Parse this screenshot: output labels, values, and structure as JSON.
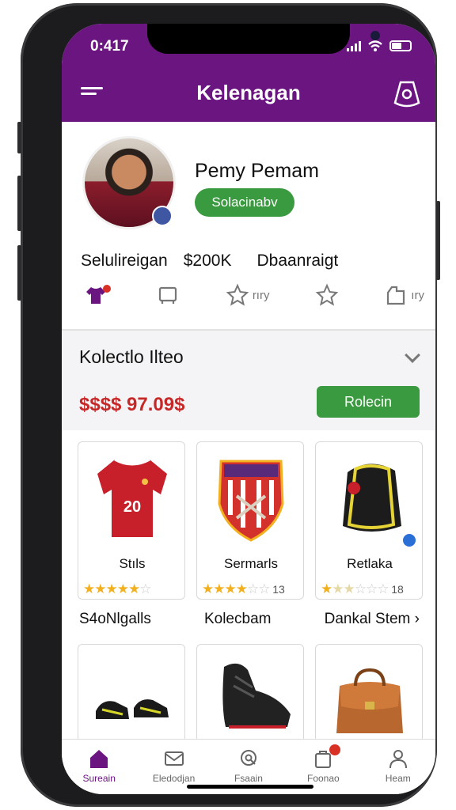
{
  "status_bar": {
    "time": "0:417"
  },
  "header": {
    "title": "Kelenagan"
  },
  "profile": {
    "name": "Pemy Pemam",
    "status": "Solacinabv",
    "stats": [
      "Selulireigan",
      "$200K",
      "Dbaanraigt"
    ]
  },
  "quick_actions": [
    {
      "icon": "jersey-icon",
      "label": ""
    },
    {
      "icon": "card-icon",
      "label": ""
    },
    {
      "icon": "star-icon",
      "label": "rıry"
    },
    {
      "icon": "star-outline-icon",
      "label": ""
    },
    {
      "icon": "bag-icon",
      "label": "ıry"
    }
  ],
  "collection": {
    "title": "Kolectlo Ilteo",
    "price": "$$$$ 97.09$",
    "button": "Rolecin"
  },
  "items_row1": [
    {
      "name": "Stıls",
      "rating": 4.5,
      "count": ""
    },
    {
      "name": "Sermarls",
      "rating": 3.5,
      "count": "13"
    },
    {
      "name": "Retlaka",
      "rating": 1.5,
      "count": "18"
    }
  ],
  "categories": [
    "S4oNlgalls",
    "Kolecbam",
    "Dankal Stem ›"
  ],
  "items_row2": [
    {
      "name": "cleats"
    },
    {
      "name": "boots"
    },
    {
      "name": "bag"
    }
  ],
  "nav": [
    {
      "label": "Sureain",
      "active": true
    },
    {
      "label": "Eledodjan",
      "active": false
    },
    {
      "label": "Fsaain",
      "active": false
    },
    {
      "label": "Foonao",
      "active": false
    },
    {
      "label": "Heam",
      "active": false
    }
  ],
  "colors": {
    "brand": "#6a1580",
    "accent_green": "#3a9a3f",
    "price_red": "#c62828"
  }
}
